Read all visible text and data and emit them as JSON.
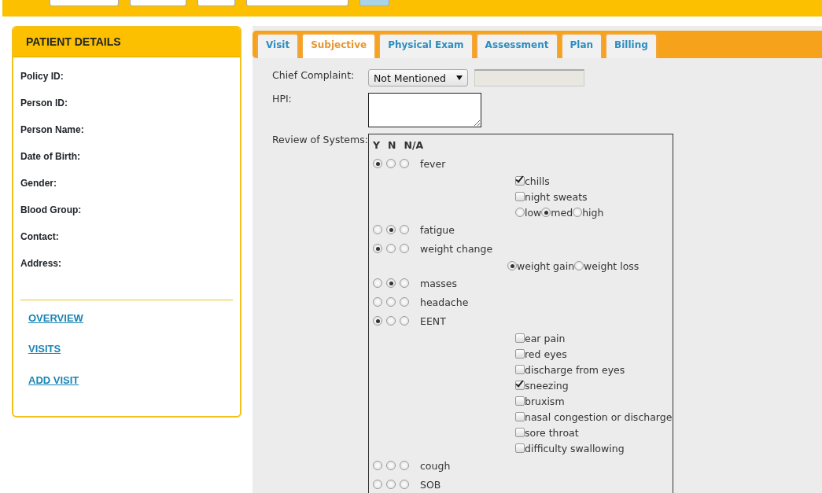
{
  "patient_details": {
    "title": "PATIENT DETAILS",
    "fields": [
      "Policy ID:",
      "Person ID:",
      "Person Name:",
      "Date of Birth:",
      "Gender:",
      "Blood Group:",
      "Contact:",
      "Address:"
    ],
    "links": [
      "OVERVIEW",
      "VISITS",
      "ADD VISIT"
    ]
  },
  "tabs": [
    {
      "label": "Visit",
      "selected": false
    },
    {
      "label": "Subjective",
      "selected": true
    },
    {
      "label": "Physical Exam",
      "selected": false
    },
    {
      "label": "Assessment",
      "selected": false
    },
    {
      "label": "Plan",
      "selected": false
    },
    {
      "label": "Billing",
      "selected": false
    }
  ],
  "chief_complaint": {
    "label": "Chief Complaint:",
    "value": "Not Mentioned"
  },
  "hpi": {
    "label": "HPI:"
  },
  "review_of_systems": {
    "label": "Review of Systems:",
    "headers": [
      "Y",
      "N",
      "N/A"
    ],
    "items": [
      {
        "name": "fever",
        "answers": [
          {
            "selected": true
          },
          {
            "selected": false
          },
          {
            "selected": false
          }
        ],
        "details": [
          {
            "kind": "checkbox",
            "label": "chills",
            "checked": true
          },
          {
            "kind": "checkbox",
            "label": "night sweats",
            "checked": false
          },
          {
            "kind": "radios",
            "options": [
              {
                "label": "low",
                "selected": false
              },
              {
                "label": "med",
                "selected": true
              },
              {
                "label": "high",
                "selected": false
              }
            ]
          }
        ]
      },
      {
        "name": "fatigue",
        "answers": [
          {
            "selected": false
          },
          {
            "selected": true
          },
          {
            "selected": false
          }
        ]
      },
      {
        "name": "weight change",
        "answers": [
          {
            "selected": true
          },
          {
            "selected": false
          },
          {
            "selected": false
          }
        ],
        "details": [
          {
            "kind": "radios",
            "options": [
              {
                "label": "weight gain",
                "selected": true
              },
              {
                "label": "weight loss",
                "selected": false
              }
            ]
          }
        ]
      },
      {
        "name": "masses",
        "answers": [
          {
            "selected": false
          },
          {
            "selected": true
          },
          {
            "selected": false
          }
        ]
      },
      {
        "name": "headache",
        "answers": [
          {
            "selected": false
          },
          {
            "selected": false
          },
          {
            "selected": false
          }
        ]
      },
      {
        "name": "EENT",
        "answers": [
          {
            "selected": true
          },
          {
            "selected": false
          },
          {
            "selected": false
          }
        ],
        "details": [
          {
            "kind": "checkbox",
            "label": "ear pain",
            "checked": false
          },
          {
            "kind": "checkbox",
            "label": "red eyes",
            "checked": false
          },
          {
            "kind": "checkbox",
            "label": "discharge from eyes",
            "checked": false
          },
          {
            "kind": "checkbox",
            "label": "sneezing",
            "checked": true
          },
          {
            "kind": "checkbox",
            "label": "bruxism",
            "checked": false
          },
          {
            "kind": "checkbox",
            "label": "nasal congestion or discharge",
            "checked": false
          },
          {
            "kind": "checkbox",
            "label": "sore throat",
            "checked": false
          },
          {
            "kind": "checkbox",
            "label": "difficulty swallowing",
            "checked": false
          }
        ]
      },
      {
        "name": "cough",
        "answers": [
          {
            "selected": false
          },
          {
            "selected": false
          },
          {
            "selected": false
          }
        ]
      },
      {
        "name": "SOB",
        "answers": [
          {
            "selected": false
          },
          {
            "selected": false
          },
          {
            "selected": false
          }
        ]
      }
    ]
  }
}
